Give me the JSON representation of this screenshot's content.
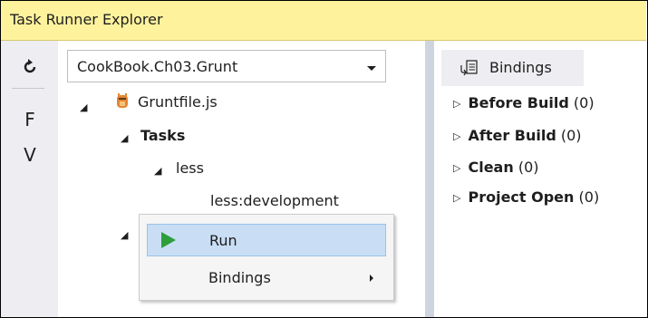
{
  "window": {
    "title": "Task Runner Explorer"
  },
  "toolbar": {
    "refresh_icon": "refresh-icon",
    "btn_f": "F",
    "btn_v": "V"
  },
  "project_select": {
    "value": "CookBook.Ch03.Grunt"
  },
  "tree": {
    "gruntfile": "Gruntfile.js",
    "tasks": "Tasks",
    "less": "less",
    "less_dev": "less:development"
  },
  "bindings_panel": {
    "tab_label": "Bindings",
    "rows": [
      {
        "name": "Before Build",
        "count": "(0)"
      },
      {
        "name": "After Build",
        "count": "(0)"
      },
      {
        "name": "Clean",
        "count": "(0)"
      },
      {
        "name": "Project Open",
        "count": "(0)"
      }
    ]
  },
  "context_menu": {
    "run": "Run",
    "bindings": "Bindings"
  },
  "colors": {
    "titlebar": "#fff29d",
    "panel": "#eeeef2",
    "highlight": "#c9def5",
    "run_green": "#2e9e3c"
  }
}
